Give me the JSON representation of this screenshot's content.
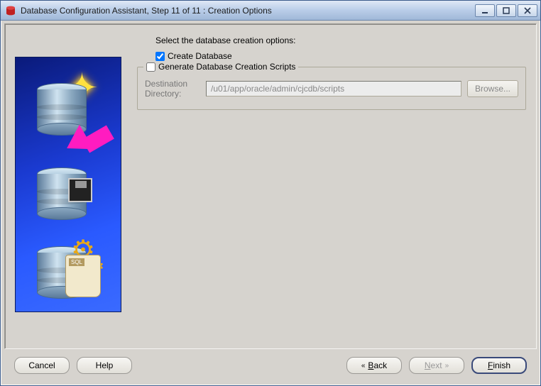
{
  "window": {
    "title": "Database Configuration Assistant, Step 11 of 11 : Creation Options"
  },
  "main": {
    "instruction": "Select the database creation options:",
    "create_db_label": "Create Database",
    "create_db_checked": true,
    "scripts_group_label": "Generate Database Creation Scripts",
    "scripts_checked": false,
    "dest_label": "Destination\nDirectory:",
    "dest_value": "/u01/app/oracle/admin/cjcdb/scripts",
    "browse_label": "Browse..."
  },
  "footer": {
    "cancel": "Cancel",
    "help": "Help",
    "back": "Back",
    "next": "Next",
    "finish": "Finish"
  }
}
